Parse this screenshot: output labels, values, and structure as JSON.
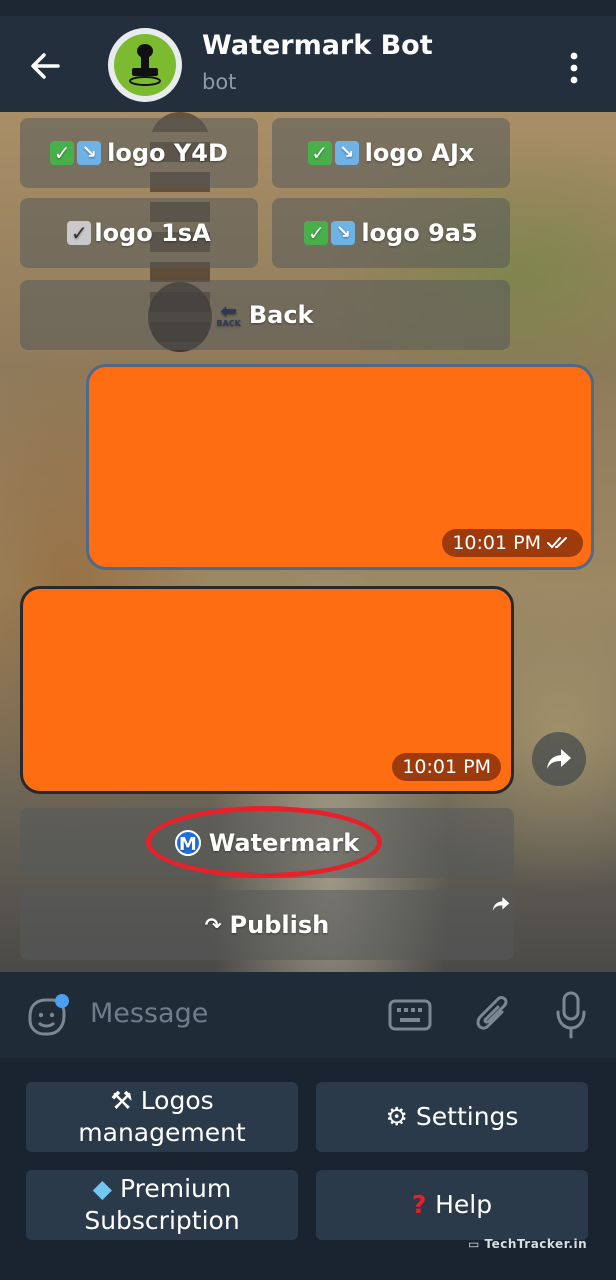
{
  "header": {
    "title": "Watermark Bot",
    "subtitle": "bot"
  },
  "inline_keyboard": {
    "rows": [
      [
        {
          "label": "logo Y4D"
        },
        {
          "label": "logo AJx"
        }
      ],
      [
        {
          "label": "logo 1sA"
        },
        {
          "label": "logo 9a5"
        }
      ]
    ],
    "back_label": "Back",
    "back_icon_text": "BACK"
  },
  "messages": [
    {
      "time": "10:01 PM",
      "direction": "outgoing"
    },
    {
      "time": "10:01 PM",
      "direction": "incoming"
    }
  ],
  "bot_buttons": {
    "watermark_label": "Watermark",
    "watermark_badge": "M",
    "publish_label": "Publish"
  },
  "composer": {
    "placeholder": "Message"
  },
  "reply_keyboard": {
    "logos": "Logos management",
    "settings": "Settings",
    "premium": "Premium Subscription",
    "help": "Help"
  },
  "brand": "TechTracker.in",
  "colors": {
    "accent": "#ff6d12",
    "highlight": "#e8202a",
    "header_bg": "#242f3d"
  }
}
